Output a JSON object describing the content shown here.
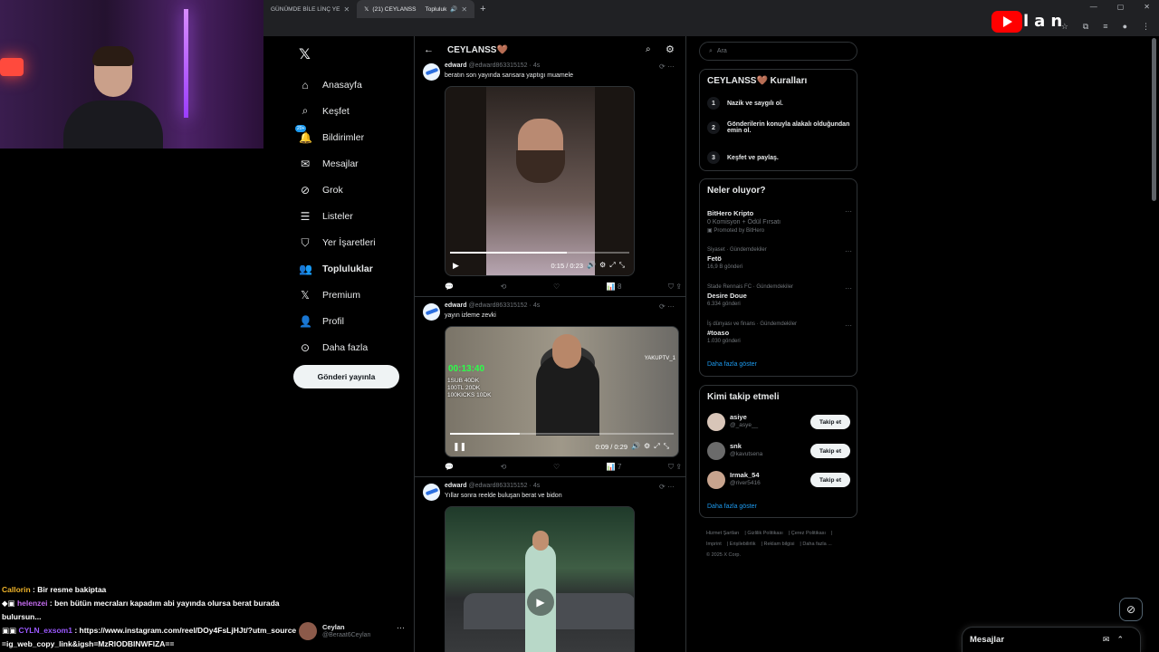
{
  "browser": {
    "tabs": [
      {
        "label": "GÜNÜMDE BİLE LİNÇ YE",
        "active": false
      },
      {
        "label": "(21) CEYLANSS",
        "active": true
      },
      {
        "label": "Topluluk",
        "active": false
      }
    ],
    "overlay_text": "lan"
  },
  "nav": {
    "items": [
      {
        "label": "Anasayfa",
        "icon": "home-icon"
      },
      {
        "label": "Keşfet",
        "icon": "search-icon"
      },
      {
        "label": "Bildirimler",
        "icon": "bell-icon",
        "badge": "20+"
      },
      {
        "label": "Mesajlar",
        "icon": "mail-icon"
      },
      {
        "label": "Grok",
        "icon": "grok-icon"
      },
      {
        "label": "Listeler",
        "icon": "list-icon"
      },
      {
        "label": "Yer İşaretleri",
        "icon": "bookmark-icon"
      },
      {
        "label": "Topluluklar",
        "icon": "communities-icon"
      },
      {
        "label": "Premium",
        "icon": "x-icon"
      },
      {
        "label": "Profil",
        "icon": "profile-icon"
      },
      {
        "label": "Daha fazla",
        "icon": "more-icon"
      }
    ],
    "post_button": "Gönderi yayınla",
    "account": {
      "name": "Ceylan",
      "handle": "@Beraat6Ceylan"
    }
  },
  "chat": [
    {
      "user": "Callorin",
      "color": "#f0b429",
      "message": "Bir resme bakiptaa"
    },
    {
      "user": "helenzei",
      "color": "#c56cf0",
      "message": "ben bütün mecraları kapadım abi yayında olursa berat burada bulursun..."
    },
    {
      "user": "CYLN_exsom1",
      "color": "#9b59ff",
      "message": "https://www.instagram.com/reel/DOy4FsLjHJt/?utm_source=ig_web_copy_link&igsh=MzRlODBlNWFlZA=="
    }
  ],
  "feed": {
    "title": "CEYLANSS🤎",
    "posts": [
      {
        "name": "edward",
        "handle": "@edward863315152",
        "time": "4s",
        "text": "beratın son yayında sansara yaptıgı muamele",
        "video_time": "0:15 / 0:23",
        "progress": 0.65,
        "views": "8"
      },
      {
        "name": "edward",
        "handle": "@edward863315152",
        "time": "4s",
        "text": "yayın izleme zevki",
        "video_time": "0:09 / 0:29",
        "progress": 0.31,
        "views": "7",
        "overlay": {
          "timer": "00:13:40",
          "lines": [
            "1SUB 40DK",
            "100TL 20DK",
            "100KICKS 10DK"
          ],
          "tag": "YAKUPTV_1"
        }
      },
      {
        "name": "edward",
        "handle": "@edward863315152",
        "time": "4s",
        "text": "Yıllar sonra reelde buluşan berat ve bidon"
      }
    ]
  },
  "right": {
    "search_placeholder": "Ara",
    "rules": {
      "title": "CEYLANSS🤎 Kuralları",
      "items": [
        {
          "num": "1",
          "text": "Nazik ve saygılı ol."
        },
        {
          "num": "2",
          "text": "Gönderilerin konuyla alakalı olduğundan emin ol."
        },
        {
          "num": "3",
          "text": "Keşfet ve paylaş."
        }
      ]
    },
    "trends": {
      "title": "Neler oluyor?",
      "items": [
        {
          "context": "",
          "title": "BitHero Kripto",
          "count": "0 Komisyon + Ödül Fırsatı",
          "promo": "Promoted by BitHero"
        },
        {
          "context": "Siyaset · Gündemdekiler",
          "title": "Fetö",
          "count": "16,9 B gönderi"
        },
        {
          "context": "Stade Rennais FC · Gündemdekiler",
          "title": "Desire Doue",
          "count": "6.334 gönderi"
        },
        {
          "context": "İş dünyası ve finans · Gündemdekiler",
          "title": "#toaso",
          "count": "1.030 gönderi"
        }
      ],
      "show_more": "Daha fazla göster"
    },
    "who_to_follow": {
      "title": "Kimi takip etmeli",
      "items": [
        {
          "name": "asiye",
          "handle": "@_asye__",
          "button": "Takip et"
        },
        {
          "name": "snk",
          "handle": "@kavutsena",
          "button": "Takip et"
        },
        {
          "name": "Irmak_54",
          "handle": "@river5416",
          "button": "Takip et"
        }
      ],
      "show_more": "Daha fazla göster"
    },
    "footer": [
      "Hizmet Şartları",
      "Gizlilik Politikası",
      "Çerez Politikası",
      "Imprint",
      "Erişilebilirlik",
      "Reklam bilgisi",
      "Daha fazla ...",
      "© 2025 X Corp."
    ]
  },
  "dock": {
    "messages_label": "Mesajlar"
  }
}
